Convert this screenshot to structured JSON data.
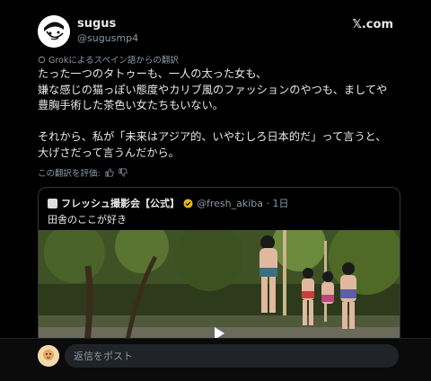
{
  "post": {
    "author_name": "sugus",
    "author_handle": "@sugusmp4",
    "site": "𝕏.com",
    "translation_note": "Grokによるスペイン語からの翻訳",
    "text": "たった一つのタトゥーも、一人の太った女も、\n嫌な感じの猫っぽい態度やカリブ風のファッションのやつも、ましてや豊胸手術した茶色い女たちもいない。\n\nそれから、私が「未来はアジア的、いやむしろ日本的だ」って言うと、大げさだって言うんだから。",
    "rate_label": "この翻訳を評価:"
  },
  "quote": {
    "name": "フレッシュ撮影会【公式】",
    "handle_time": "@fresh_akiba · 1日",
    "text": "田舎のここが好き"
  },
  "reply": {
    "placeholder": "返信をポスト"
  },
  "colors": {
    "background": "#000000",
    "text": "#e7e9ea",
    "secondary": "#8b98a5",
    "border": "#333639",
    "verified_gold": "#e2b719"
  },
  "icons": {
    "translate": "refresh-circle-icon",
    "thumbs_up": "thumbs-up-icon",
    "thumbs_down": "thumbs-down-icon",
    "play": "play-icon",
    "verified": "verified-badge-icon"
  }
}
